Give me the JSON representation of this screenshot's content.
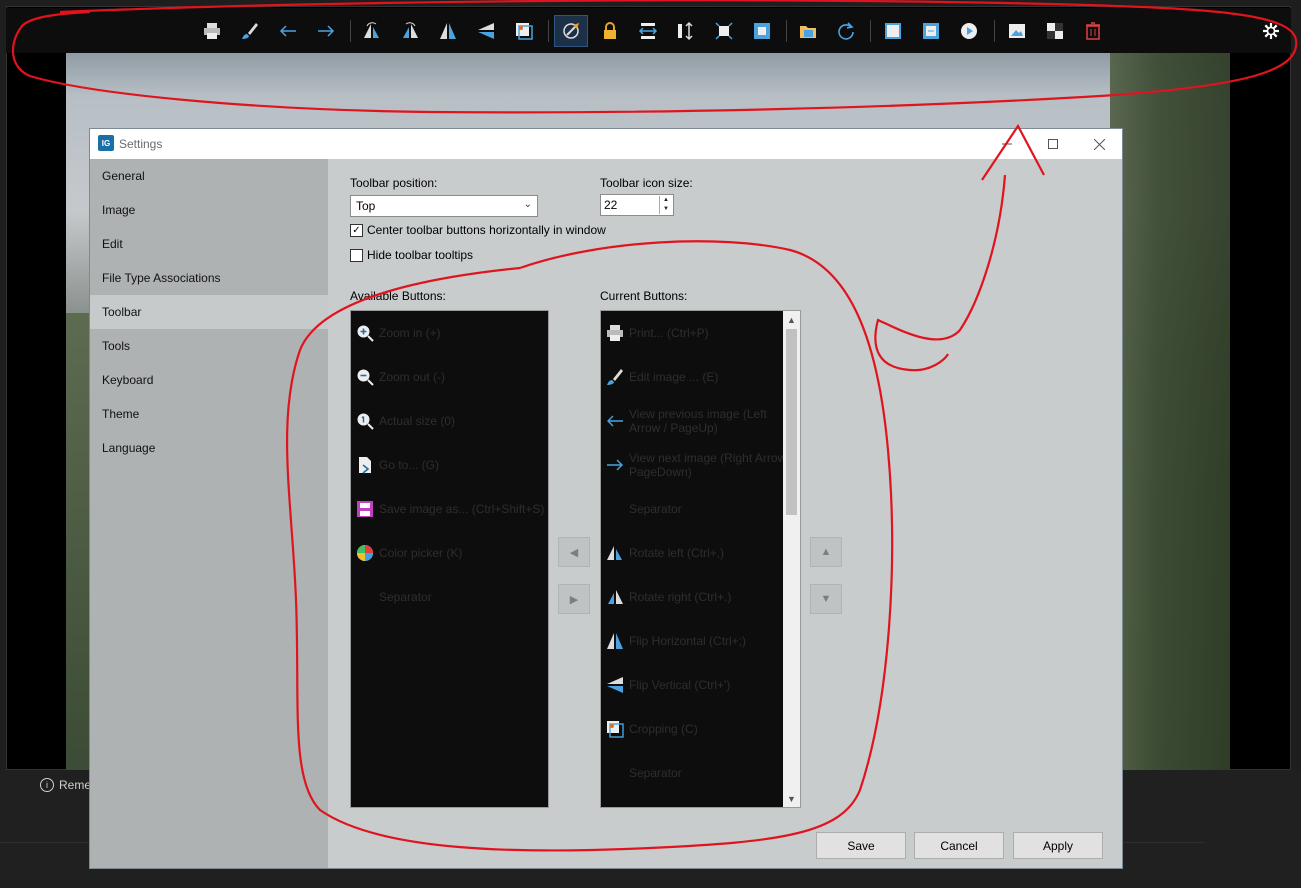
{
  "colors": {
    "annotation": "#e0141e",
    "toolbar_bg": "#0d0d0d",
    "icon_accent": "#4aa3df",
    "sidebar_bg": "#afb2b3",
    "content_bg": "#c8cccd"
  },
  "app_toolbar": {
    "buttons": [
      {
        "icon": "printer-icon"
      },
      {
        "icon": "brush-icon"
      },
      {
        "icon": "arrow-left-icon"
      },
      {
        "icon": "arrow-right-icon"
      },
      {
        "icon": "rotate-left-icon"
      },
      {
        "icon": "rotate-right-icon"
      },
      {
        "icon": "flip-horizontal-icon"
      },
      {
        "icon": "flip-vertical-icon"
      },
      {
        "icon": "crop-icon"
      },
      {
        "icon": "pan-icon"
      },
      {
        "icon": "lock-icon"
      },
      {
        "icon": "fit-width-icon"
      },
      {
        "icon": "fit-height-icon"
      },
      {
        "icon": "fit-window-icon"
      },
      {
        "icon": "auto-zoom-icon"
      },
      {
        "icon": "open-folder-icon"
      },
      {
        "icon": "refresh-icon"
      },
      {
        "icon": "window-frame-icon"
      },
      {
        "icon": "fullscreen-icon"
      },
      {
        "icon": "slideshow-icon"
      },
      {
        "icon": "wallpaper-icon"
      },
      {
        "icon": "checkerboard-icon"
      },
      {
        "icon": "delete-icon"
      }
    ],
    "settings_icon": "settings-gear-icon"
  },
  "status": {
    "text": "Reme"
  },
  "window": {
    "title": "Settings",
    "app_icon_text": "IG"
  },
  "sidebar": {
    "items": [
      {
        "label": "General"
      },
      {
        "label": "Image"
      },
      {
        "label": "Edit"
      },
      {
        "label": "File Type Associations"
      },
      {
        "label": "Toolbar"
      },
      {
        "label": "Tools"
      },
      {
        "label": "Keyboard"
      },
      {
        "label": "Theme"
      },
      {
        "label": "Language"
      }
    ],
    "selected": "Toolbar"
  },
  "toolbar_settings": {
    "position_label": "Toolbar position:",
    "position_value": "Top",
    "icon_size_label": "Toolbar icon size:",
    "icon_size_value": "22",
    "center_label": "Center toolbar buttons horizontally in window",
    "center_checked": true,
    "hide_tooltips_label": "Hide toolbar tooltips",
    "hide_tooltips_checked": false
  },
  "available": {
    "label": "Available Buttons:",
    "items": [
      {
        "icon": "zoom-in-icon",
        "text": "Zoom in (+)"
      },
      {
        "icon": "zoom-out-icon",
        "text": "Zoom out (-)"
      },
      {
        "icon": "actual-size-icon",
        "text": "Actual size (0)"
      },
      {
        "icon": "goto-icon",
        "text": "Go to... (G)"
      },
      {
        "icon": "save-as-icon",
        "text": "Save image as... (Ctrl+Shift+S)"
      },
      {
        "icon": "color-picker-icon",
        "text": "Color picker (K)"
      },
      {
        "icon": "",
        "text": "Separator"
      }
    ]
  },
  "current": {
    "label": "Current Buttons:",
    "items": [
      {
        "icon": "printer-icon",
        "text": "Print... (Ctrl+P)"
      },
      {
        "icon": "brush-icon",
        "text": "Edit image ... (E)"
      },
      {
        "icon": "arrow-left-icon",
        "text": "View previous image (Left Arrow / PageUp)"
      },
      {
        "icon": "arrow-right-icon",
        "text": "View next image (Right Arrow / PageDown)"
      },
      {
        "icon": "",
        "text": "Separator"
      },
      {
        "icon": "rotate-left-icon",
        "text": "Rotate left (Ctrl+,)"
      },
      {
        "icon": "rotate-right-icon",
        "text": "Rotate right (Ctrl+.)"
      },
      {
        "icon": "flip-horizontal-icon",
        "text": "Flip Horizontal (Ctrl+;)"
      },
      {
        "icon": "flip-vertical-icon",
        "text": "Flip Vertical (Ctrl+')"
      },
      {
        "icon": "crop-icon",
        "text": "Cropping (C)"
      },
      {
        "icon": "",
        "text": "Separator"
      }
    ]
  },
  "move": {
    "left": "◀",
    "right": "▶",
    "up": "▲",
    "down": "▼"
  },
  "footer": {
    "save": "Save",
    "cancel": "Cancel",
    "apply": "Apply"
  }
}
